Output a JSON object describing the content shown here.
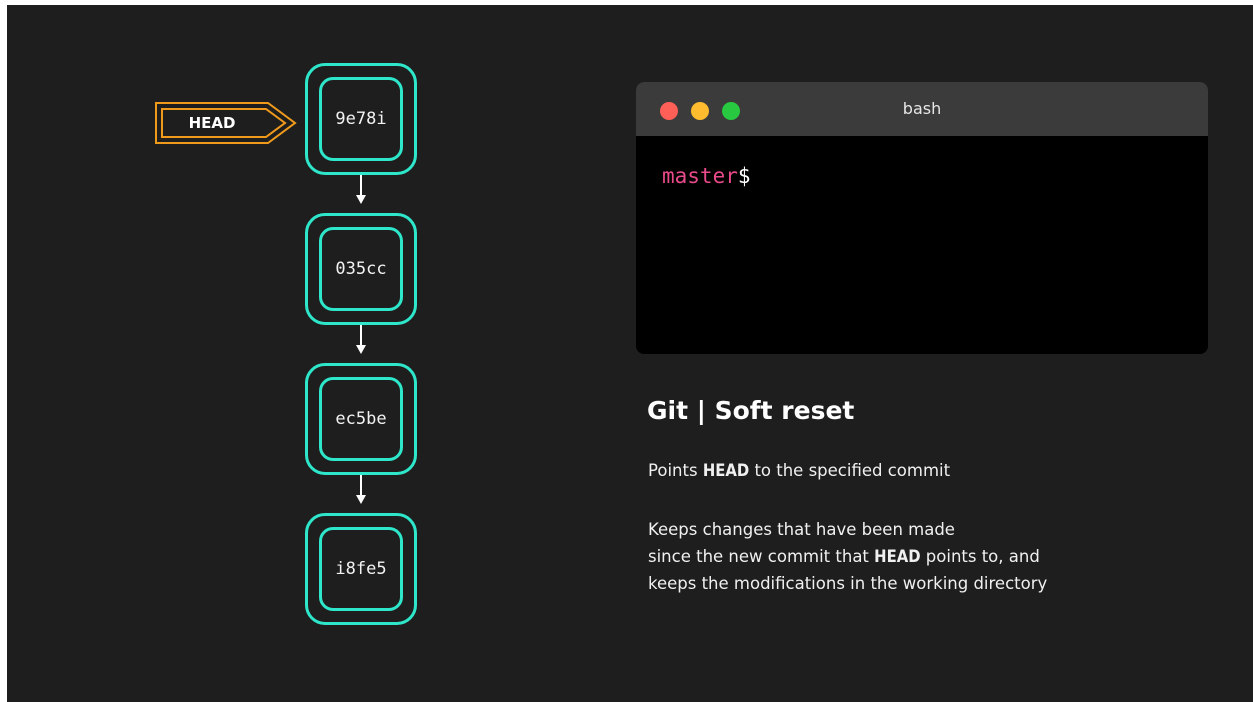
{
  "head_pointer": {
    "label": "HEAD"
  },
  "commits": [
    {
      "hash": "9e78i"
    },
    {
      "hash": "035cc"
    },
    {
      "hash": "ec5be"
    },
    {
      "hash": "i8fe5"
    }
  ],
  "terminal": {
    "title": "bash",
    "prompt_branch": "master",
    "prompt_symbol": "$"
  },
  "description": {
    "title": "Git | Soft reset",
    "line1_pre": "Points ",
    "line1_kw": "HEAD",
    "line1_post": " to the specified commit",
    "line2": "Keeps changes that have been made",
    "line3_pre": "since the new commit that ",
    "line3_kw": "HEAD",
    "line3_post": " points to, and",
    "line4": "keeps the modifications in the working directory"
  },
  "colors": {
    "background": "#1e1e1e",
    "commit_border": "#2ee6c9",
    "head_pointer": "#f09a1c",
    "prompt_branch": "#e84a8a",
    "terminal_body": "#000000",
    "terminal_titlebar": "#3b3b3b"
  }
}
